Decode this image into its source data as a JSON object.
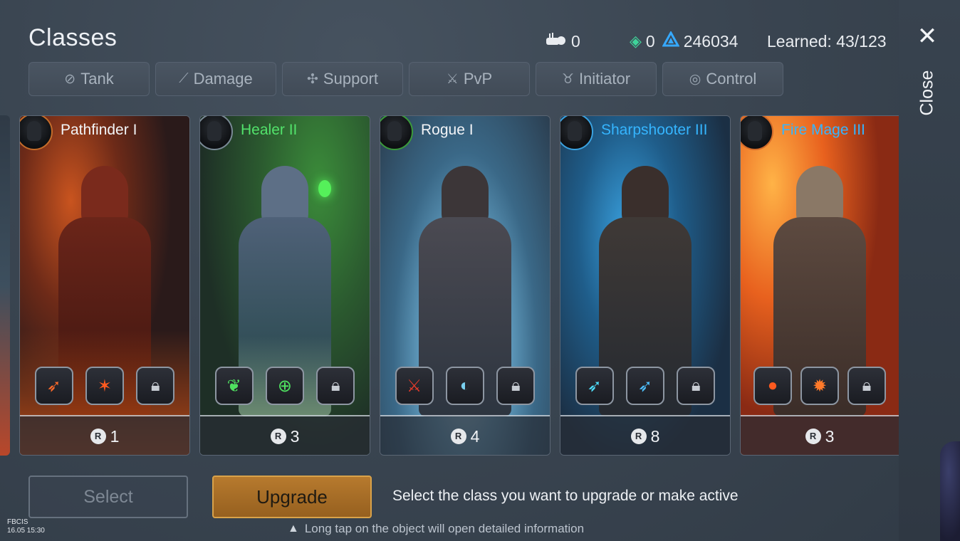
{
  "header": {
    "title": "Classes",
    "resource_a": "0",
    "resource_b": "0",
    "resource_c": "246034",
    "learned": "Learned: 43/123"
  },
  "close": {
    "icon": "✕",
    "label": "Close"
  },
  "tabs": [
    {
      "label": "Tank",
      "icon": "tank-icon"
    },
    {
      "label": "Damage",
      "icon": "damage-icon"
    },
    {
      "label": "Support",
      "icon": "support-icon"
    },
    {
      "label": "PvP",
      "icon": "pvp-icon"
    },
    {
      "label": "Initiator",
      "icon": "initiator-icon"
    },
    {
      "label": "Control",
      "icon": "control-icon"
    }
  ],
  "cards": [
    {
      "name": "Pathfinder I",
      "rank": "1",
      "theme": "fire",
      "name_color": "#f2f4f7"
    },
    {
      "name": "Healer II",
      "rank": "3",
      "theme": "nature",
      "name_color": "#52e26b"
    },
    {
      "name": "Rogue I",
      "rank": "4",
      "theme": "ice",
      "name_color": "#f2f4f7"
    },
    {
      "name": "Sharpshooter III",
      "rank": "8",
      "theme": "storm",
      "name_color": "#35b5ff"
    },
    {
      "name": "Fire Mage III",
      "rank": "3",
      "theme": "fire",
      "name_color": "#35b5ff"
    }
  ],
  "buttons": {
    "select": "Select",
    "upgrade": "Upgrade"
  },
  "instruction": "Select the class you want to upgrade or make active",
  "tip": "Long tap on the object will open detailed information",
  "watermark": {
    "line1": "FBCIS",
    "line2": "16.05 15:30"
  },
  "colors": {
    "accent_gold": "#b77a2e",
    "green_name": "#52e26b",
    "blue_name": "#35b5ff"
  }
}
